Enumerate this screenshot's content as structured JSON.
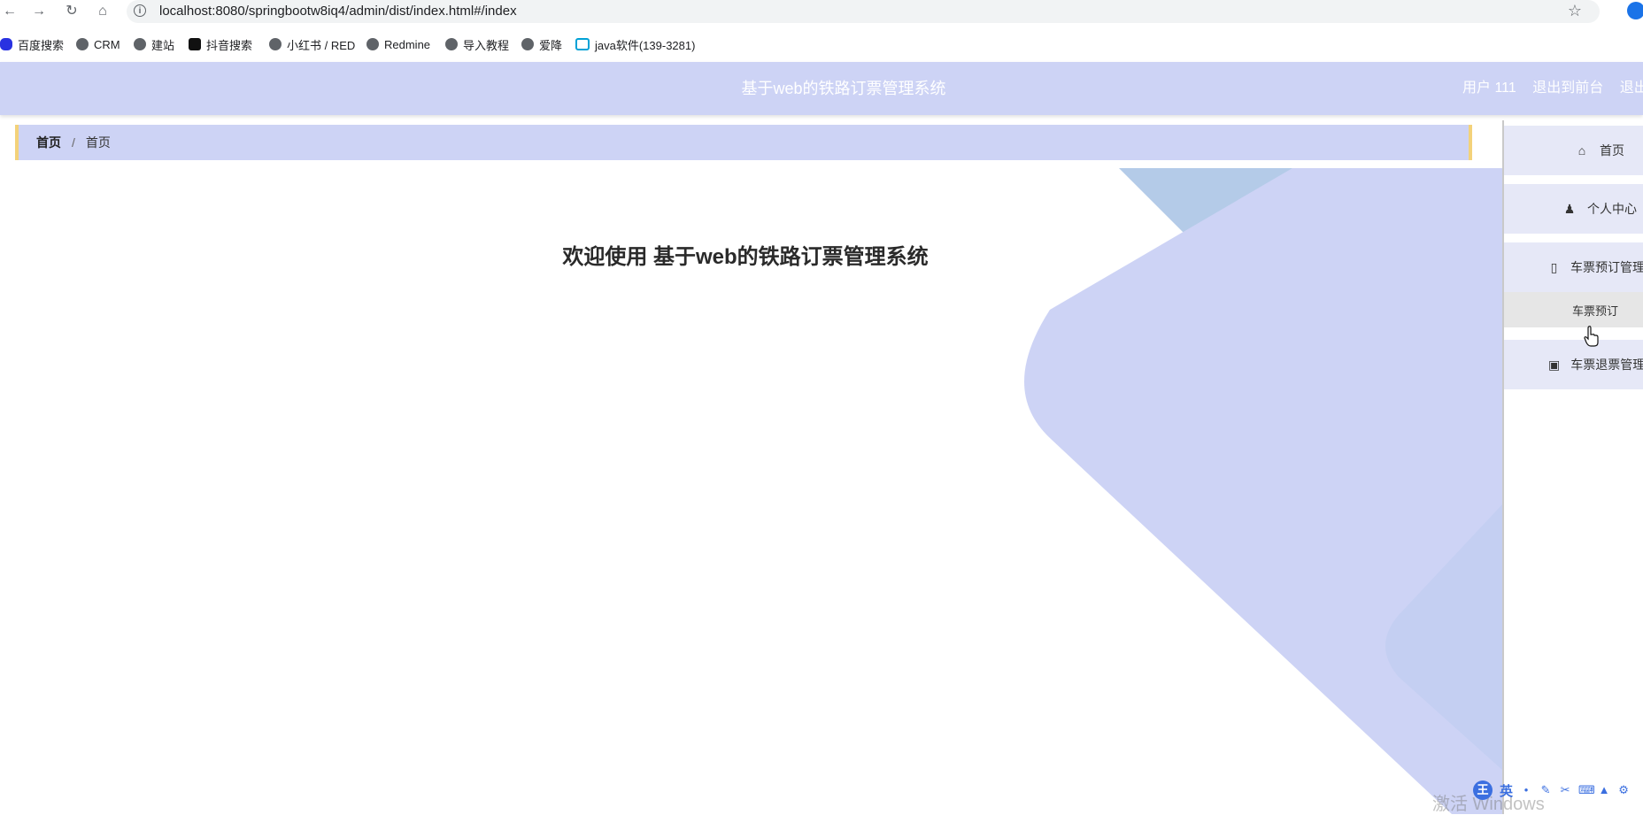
{
  "browser": {
    "url": "localhost:8080/springbootw8iq4/admin/dist/index.html#/index",
    "bookmarks": [
      {
        "label": "百度搜索",
        "icon": "baidu-icon"
      },
      {
        "label": "CRM",
        "icon": "globe-icon"
      },
      {
        "label": "建站",
        "icon": "globe-icon"
      },
      {
        "label": "抖音搜索",
        "icon": "douyin-icon"
      },
      {
        "label": "小红书 / RED",
        "icon": "globe-icon"
      },
      {
        "label": "Redmine",
        "icon": "globe-icon"
      },
      {
        "label": "导入教程",
        "icon": "globe-icon"
      },
      {
        "label": "爱降",
        "icon": "globe-icon"
      },
      {
        "label": "java软件(139-3281)",
        "icon": "bilibili-icon"
      }
    ]
  },
  "header": {
    "title": "基于web的铁路订票管理系统",
    "user": "用户 111",
    "to_front": "退出到前台",
    "logout": "退出登"
  },
  "breadcrumb": {
    "home": "首页",
    "separator": "/",
    "current": "首页"
  },
  "main": {
    "welcome": "欢迎使用 基于web的铁路订票管理系统"
  },
  "sidebar": {
    "items": [
      {
        "label": "首页",
        "icon": "home-icon"
      },
      {
        "label": "个人中心",
        "icon": "user-icon"
      },
      {
        "label": "车票预订管理",
        "icon": "message-icon"
      },
      {
        "label": "车票退票管理",
        "icon": "briefcase-icon"
      }
    ],
    "submenu": {
      "label": "车票预订"
    }
  },
  "taskbar": {
    "ime_logo": "王",
    "ime_lang": "英",
    "watermark": "激活 Windows"
  },
  "colors": {
    "header_bg": "#cdd3f5",
    "breadcrumb_border": "#f3d27a",
    "sidebar_item_bg": "#e6e8f7",
    "deco_shape": "#cdd3f5",
    "deco_shape_alt": "#b4cbe8"
  }
}
